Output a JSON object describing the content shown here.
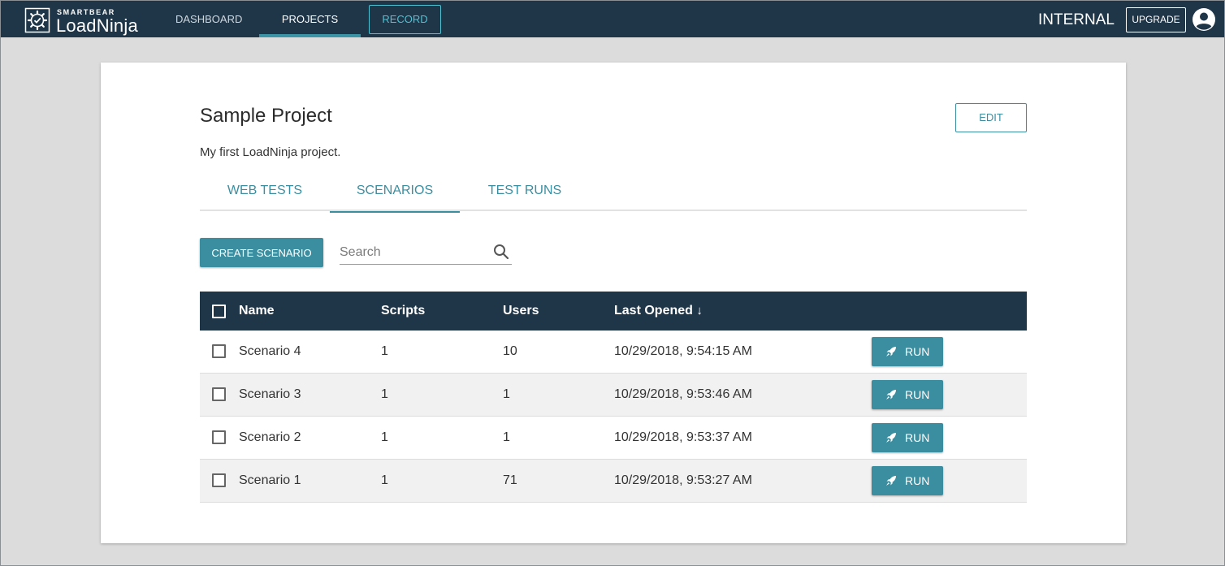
{
  "colors": {
    "topbar": "#1f3548",
    "accent": "#3b8ea0",
    "record": "#4fc3d4",
    "page_bg": "#dcdcdc"
  },
  "brand": {
    "company": "SMARTBEAR",
    "product": "LoadNinja"
  },
  "nav": {
    "dashboard": "DASHBOARD",
    "projects": "PROJECTS",
    "record": "RECORD",
    "active": "PROJECTS"
  },
  "header_right": {
    "workspace": "INTERNAL",
    "upgrade": "UPGRADE",
    "avatar_icon": "user-circle-icon"
  },
  "project": {
    "title": "Sample Project",
    "description": "My first LoadNinja project.",
    "edit_label": "EDIT"
  },
  "tabs": [
    {
      "label": "WEB TESTS"
    },
    {
      "label": "SCENARIOS",
      "active": true
    },
    {
      "label": "TEST RUNS"
    }
  ],
  "toolbar": {
    "create_label": "CREATE SCENARIO",
    "search_placeholder": "Search"
  },
  "table": {
    "columns": {
      "name": "Name",
      "scripts": "Scripts",
      "users": "Users",
      "last_opened": "Last Opened",
      "sort_indicator": "↓"
    },
    "rows": [
      {
        "name": "Scenario 4",
        "scripts": "1",
        "users": "10",
        "last_opened": "10/29/2018, 9:54:15 AM",
        "action": "RUN"
      },
      {
        "name": "Scenario 3",
        "scripts": "1",
        "users": "1",
        "last_opened": "10/29/2018, 9:53:46 AM",
        "action": "RUN"
      },
      {
        "name": "Scenario 2",
        "scripts": "1",
        "users": "1",
        "last_opened": "10/29/2018, 9:53:37 AM",
        "action": "RUN"
      },
      {
        "name": "Scenario 1",
        "scripts": "1",
        "users": "71",
        "last_opened": "10/29/2018, 9:53:27 AM",
        "action": "RUN"
      }
    ]
  }
}
